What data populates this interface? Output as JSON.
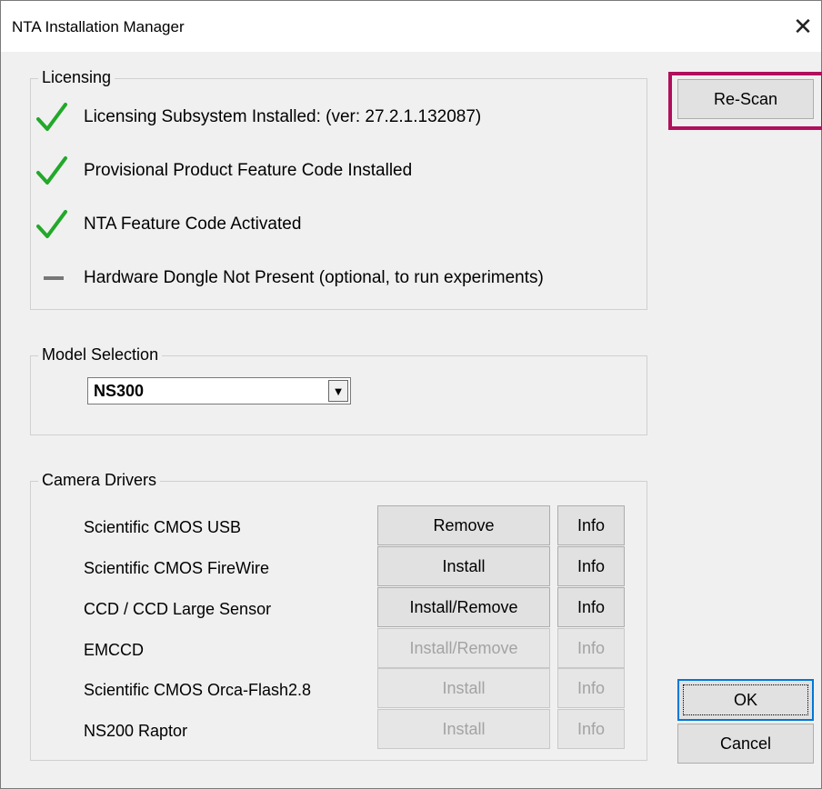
{
  "window": {
    "title": "NTA Installation Manager",
    "close_glyph": "✕"
  },
  "licensing": {
    "legend": "Licensing",
    "items": [
      {
        "status": "check-icon",
        "text": "Licensing Subsystem Installed: (ver: 27.2.1.132087)"
      },
      {
        "status": "check-icon",
        "text": "Provisional Product Feature Code Installed"
      },
      {
        "status": "check-icon",
        "text": "NTA Feature Code Activated"
      },
      {
        "status": "dash-icon",
        "text": "Hardware Dongle Not Present (optional, to run experiments)"
      }
    ]
  },
  "model_selection": {
    "legend": "Model Selection",
    "selected": "NS300",
    "arrow_glyph": "▼"
  },
  "camera_drivers": {
    "legend": "Camera Drivers",
    "rows": [
      {
        "name": "Scientific CMOS USB",
        "action": "Remove",
        "action_enabled": true,
        "info": "Info",
        "info_enabled": true
      },
      {
        "name": "Scientific CMOS FireWire",
        "action": "Install",
        "action_enabled": true,
        "info": "Info",
        "info_enabled": true
      },
      {
        "name": "CCD / CCD Large Sensor",
        "action": "Install/Remove",
        "action_enabled": true,
        "info": "Info",
        "info_enabled": true
      },
      {
        "name": "EMCCD",
        "action": "Install/Remove",
        "action_enabled": false,
        "info": "Info",
        "info_enabled": false
      },
      {
        "name": "Scientific CMOS Orca-Flash2.8",
        "action": "Install",
        "action_enabled": false,
        "info": "Info",
        "info_enabled": false
      },
      {
        "name": "NS200 Raptor",
        "action": "Install",
        "action_enabled": false,
        "info": "Info",
        "info_enabled": false
      }
    ]
  },
  "buttons": {
    "rescan": "Re-Scan",
    "ok": "OK",
    "cancel": "Cancel"
  },
  "colors": {
    "check": "#22a82a",
    "highlight": "#b0105c"
  }
}
